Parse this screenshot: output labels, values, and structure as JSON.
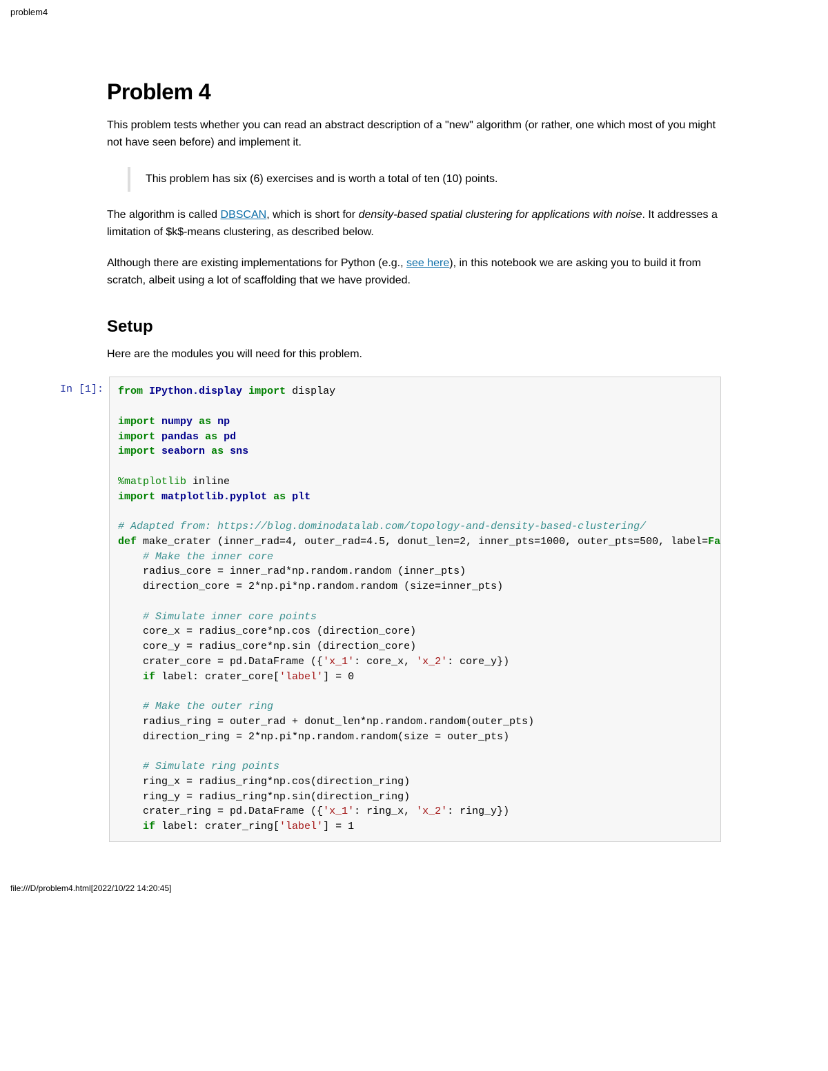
{
  "header": {
    "title": "problem4"
  },
  "doc": {
    "h1": "Problem 4",
    "intro": "This problem tests whether you can read an abstract description of a \"new\" algorithm (or rather, one which most of you might not have seen before) and implement it.",
    "callout": "This problem has six (6) exercises and is worth a total of ten (10) points.",
    "algo_pre": "The algorithm is called ",
    "algo_link": "DBSCAN",
    "algo_mid": ", which is short for ",
    "algo_em": "density-based spatial clustering for applications with noise",
    "algo_post": ". It addresses a limitation of $k$-means clustering, as described below.",
    "impl_pre": "Although there are existing implementations for Python (e.g., ",
    "impl_link": "see here",
    "impl_post": "), in this notebook we are asking you to build it from scratch, albeit using a lot of scaffolding that we have provided.",
    "h2_setup": "Setup",
    "setup_text": "Here are the modules you will need for this problem."
  },
  "cell": {
    "prompt": "In [1]:",
    "code": {
      "l1_from": "from",
      "l1_mod": "IPython.display",
      "l1_imp": "import",
      "l1_name": "display",
      "l3_imp": "import",
      "l3_mod": "numpy",
      "l3_as": "as",
      "l3_al": "np",
      "l4_imp": "import",
      "l4_mod": "pandas",
      "l4_as": "as",
      "l4_al": "pd",
      "l5_imp": "import",
      "l5_mod": "seaborn",
      "l5_as": "as",
      "l5_al": "sns",
      "l7_magic": "%matplotlib",
      "l7_arg": " inline",
      "l8_imp": "import",
      "l8_mod": "matplotlib.pyplot",
      "l8_as": "as",
      "l8_al": "plt",
      "l10_cm": "# Adapted from: https://blog.dominodatalab.com/topology-and-density-based-clustering/",
      "l11_def": "def",
      "l11_rest_a": " make_crater (inner_rad=4, outer_rad=4.5, donut_len=2, inner_pts=1000, outer_pts=500, label=",
      "l11_false": "False",
      "l11_rest_b": "):",
      "l12_cm": "    # Make the inner core",
      "l13": "    radius_core = inner_rad*np.random.random (inner_pts)",
      "l14": "    direction_core = 2*np.pi*np.random.random (size=inner_pts)",
      "l16_cm": "    # Simulate inner core points",
      "l17": "    core_x = radius_core*np.cos (direction_core)",
      "l18": "    core_y = radius_core*np.sin (direction_core)",
      "l19a": "    crater_core = pd.DataFrame ({",
      "l19s1": "'x_1'",
      "l19b": ": core_x, ",
      "l19s2": "'x_2'",
      "l19c": ": core_y})",
      "l20_if": "    if",
      "l20a": " label: crater_core[",
      "l20s": "'label'",
      "l20b": "] = 0",
      "l22_cm": "    # Make the outer ring",
      "l23": "    radius_ring = outer_rad + donut_len*np.random.random(outer_pts)",
      "l24": "    direction_ring = 2*np.pi*np.random.random(size = outer_pts)",
      "l26_cm": "    # Simulate ring points",
      "l27": "    ring_x = radius_ring*np.cos(direction_ring)",
      "l28": "    ring_y = radius_ring*np.sin(direction_ring)",
      "l29a": "    crater_ring = pd.DataFrame ({",
      "l29s1": "'x_1'",
      "l29b": ": ring_x, ",
      "l29s2": "'x_2'",
      "l29c": ": ring_y})",
      "l30_if": "    if",
      "l30a": " label: crater_ring[",
      "l30s": "'label'",
      "l30b": "] = 1"
    }
  },
  "footer": {
    "text": "file:///D/problem4.html[2022/10/22 14:20:45]"
  }
}
